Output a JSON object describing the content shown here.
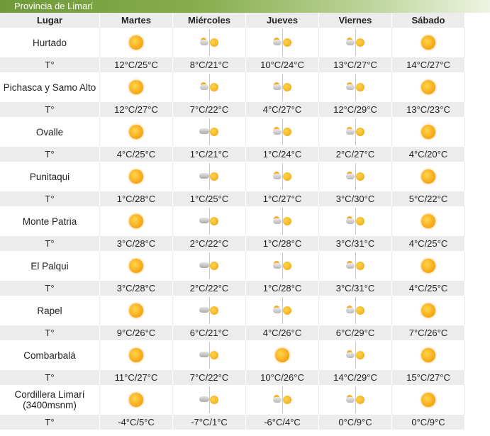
{
  "banner": "Provincia de Limarí",
  "headers": [
    "Lugar",
    "Martes",
    "Miércoles",
    "Jueves",
    "Viernes",
    "Sábado"
  ],
  "temp_label": "T°",
  "rows": [
    {
      "place": "Hurtado",
      "icons": [
        "sun",
        "partly-cloudy",
        "partly-cloudy",
        "partly-cloudy",
        "sun"
      ],
      "temps": [
        "12°C/25°C",
        "8°C/21°C",
        "10°C/24°C",
        "13°C/27°C",
        "14°C/27°C"
      ]
    },
    {
      "place": "Pichasca y Samo Alto",
      "icons": [
        "sun",
        "partly-cloudy",
        "partly-cloudy",
        "partly-cloudy",
        "sun"
      ],
      "temps": [
        "12°C/27°C",
        "7°C/22°C",
        "4°C/27°C",
        "12°C/29°C",
        "13°C/23°C"
      ]
    },
    {
      "place": "Ovalle",
      "icons": [
        "sun",
        "cloudy-sun",
        "partly-cloudy",
        "partly-cloudy",
        "sun"
      ],
      "temps": [
        "4°C/25°C",
        "1°C/21°C",
        "1°C/24°C",
        "2°C/27°C",
        "4°C/20°C"
      ]
    },
    {
      "place": "Punitaqui",
      "icons": [
        "sun",
        "cloudy-sun",
        "partly-cloudy",
        "partly-cloudy",
        "sun"
      ],
      "temps": [
        "1°C/28°C",
        "1°C/25°C",
        "1°C/27°C",
        "3°C/30°C",
        "5°C/22°C"
      ]
    },
    {
      "place": "Monte Patria",
      "icons": [
        "sun",
        "cloudy-sun",
        "partly-cloudy",
        "partly-cloudy",
        "sun"
      ],
      "temps": [
        "3°C/28°C",
        "2°C/22°C",
        "1°C/28°C",
        "3°C/31°C",
        "4°C/25°C"
      ]
    },
    {
      "place": "El Palqui",
      "icons": [
        "sun",
        "cloudy-sun",
        "partly-cloudy",
        "partly-cloudy",
        "sun"
      ],
      "temps": [
        "3°C/28°C",
        "2°C/22°C",
        "1°C/28°C",
        "3°C/31°C",
        "4°C/25°C"
      ]
    },
    {
      "place": "Rapel",
      "icons": [
        "sun",
        "cloudy-sun",
        "partly-cloudy",
        "partly-cloudy",
        "sun"
      ],
      "temps": [
        "9°C/26°C",
        "6°C/21°C",
        "4°C/26°C",
        "6°C/29°C",
        "7°C/26°C"
      ]
    },
    {
      "place": "Combarbalá",
      "icons": [
        "sun",
        "cloudy-sun",
        "sun",
        "partly-cloudy",
        "sun"
      ],
      "temps": [
        "11°C/27°C",
        "7°C/22°C",
        "10°C/26°C",
        "14°C/29°C",
        "15°C/27°C"
      ]
    },
    {
      "place": "Cordillera Limarí (3400msnm)",
      "icons": [
        "sun",
        "cloudy-sun",
        "partly-cloudy",
        "partly-cloudy",
        "sun"
      ],
      "temps": [
        "-4°C/5°C",
        "-7°C/1°C",
        "-6°C/4°C",
        "0°C/9°C",
        "0°C/9°C"
      ]
    }
  ]
}
